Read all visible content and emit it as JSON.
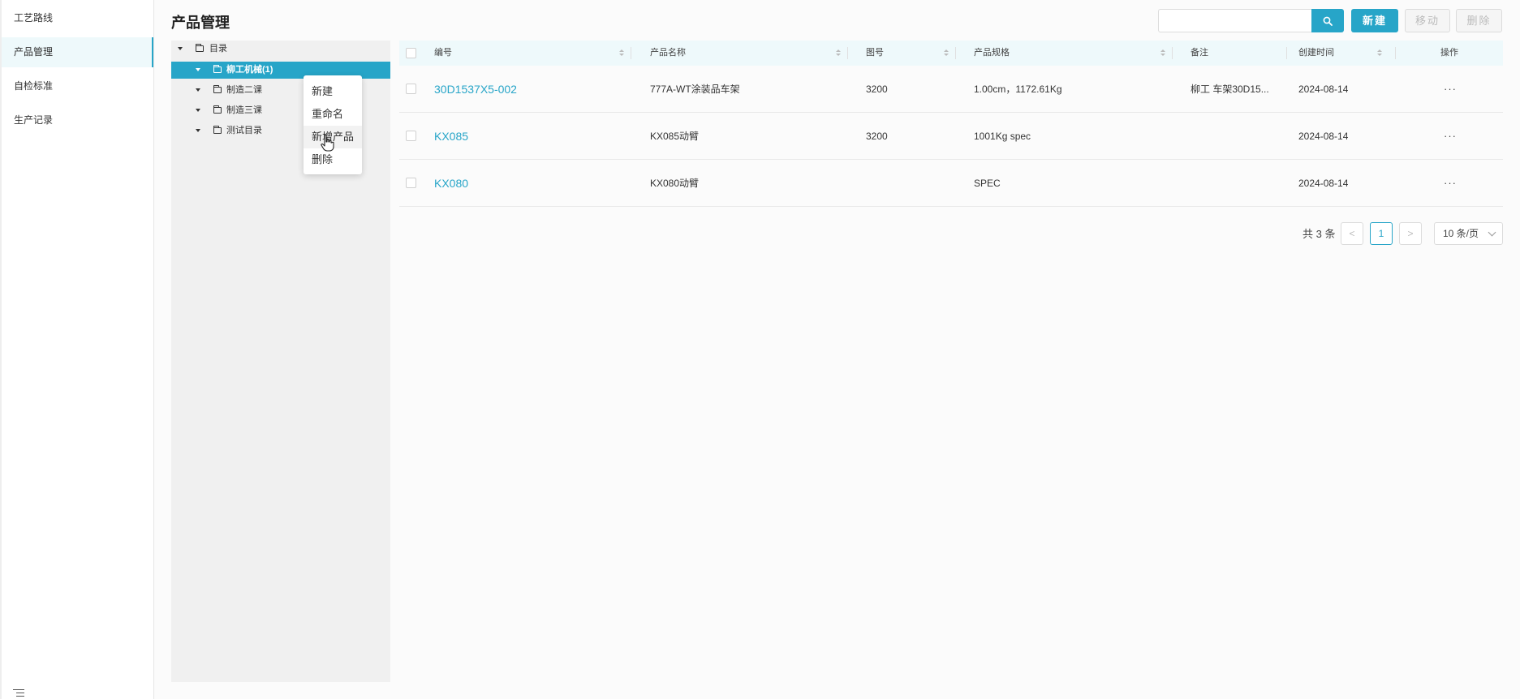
{
  "sidebar": {
    "items": [
      {
        "label": "工艺路线"
      },
      {
        "label": "产品管理",
        "active": true
      },
      {
        "label": "自检标准"
      },
      {
        "label": "生产记录"
      }
    ]
  },
  "header": {
    "title": "产品管理",
    "search_placeholder": "",
    "new_label": "新建",
    "move_label": "移动",
    "delete_label": "删除"
  },
  "tree": {
    "nodes": [
      {
        "label": "目录",
        "level": 0
      },
      {
        "label": "柳工机械(1)",
        "level": 1,
        "selected": true
      },
      {
        "label": "制造二课",
        "level": 1
      },
      {
        "label": "制造三课",
        "level": 1
      },
      {
        "label": "测试目录",
        "level": 1
      }
    ]
  },
  "context_menu": {
    "items": [
      "新建",
      "重命名",
      "新增产品",
      "删除"
    ],
    "hovered": "新增产品"
  },
  "table": {
    "columns": [
      "编号",
      "产品名称",
      "图号",
      "产品规格",
      "备注",
      "创建时间",
      "操作"
    ],
    "rows": [
      {
        "code": "30D1537X5-002",
        "name": "777A-WT涂装品车架",
        "drawing": "3200",
        "spec": "1.00cm，1172.61Kg",
        "remark": "柳工 车架30D15...",
        "created": "2024-08-14",
        "action": "···"
      },
      {
        "code": "KX085",
        "name": "KX085动臂",
        "drawing": "3200",
        "spec": "1001Kg spec",
        "remark": "",
        "created": "2024-08-14",
        "action": "···"
      },
      {
        "code": "KX080",
        "name": "KX080动臂",
        "drawing": "",
        "spec": "SPEC",
        "remark": "",
        "created": "2024-08-14",
        "action": "···"
      }
    ]
  },
  "pagination": {
    "total_label": "共 3 条",
    "current_page": "1",
    "prev": "<",
    "next": ">",
    "page_size": "10 条/页"
  },
  "colors": {
    "accent": "#27a5c8",
    "header_bg": "#eef9fb",
    "tree_bg": "#f0f0f0"
  }
}
